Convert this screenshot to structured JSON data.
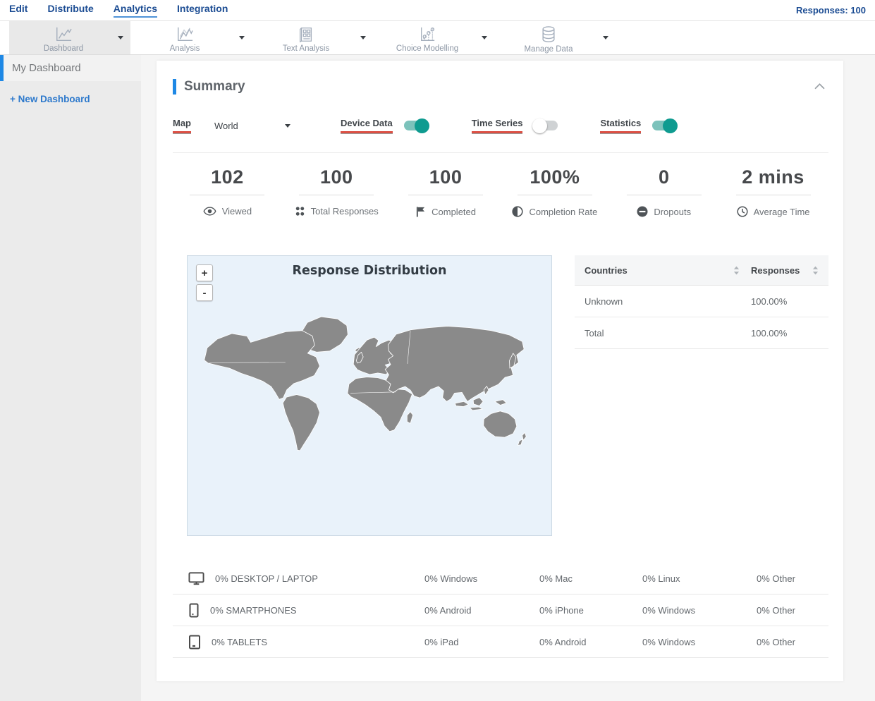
{
  "topnav": {
    "items": [
      {
        "label": "Edit",
        "active": false
      },
      {
        "label": "Distribute",
        "active": false
      },
      {
        "label": "Analytics",
        "active": true
      },
      {
        "label": "Integration",
        "active": false
      }
    ],
    "responses_label": "Responses: 100"
  },
  "toolbar": {
    "items": [
      {
        "label": "Dashboard",
        "icon": "line-chart-icon",
        "selected": true
      },
      {
        "label": "Analysis",
        "icon": "multi-line-chart-icon",
        "selected": false
      },
      {
        "label": "Text Analysis",
        "icon": "document-grid-icon",
        "selected": false
      },
      {
        "label": "Choice Modelling",
        "icon": "scatter-chart-icon",
        "selected": false
      },
      {
        "label": "Manage Data",
        "icon": "database-icon",
        "selected": false
      }
    ]
  },
  "sidebar": {
    "active_item": "My Dashboard",
    "new_dashboard": "+ New Dashboard"
  },
  "summary": {
    "title": "Summary",
    "controls": {
      "map_label": "Map",
      "map_value": "World",
      "device_data_label": "Device Data",
      "device_data_on": true,
      "time_series_label": "Time Series",
      "time_series_on": false,
      "statistics_label": "Statistics",
      "statistics_on": true
    },
    "stats": [
      {
        "value": "102",
        "label": "Viewed",
        "icon": "eye-icon"
      },
      {
        "value": "100",
        "label": "Total Responses",
        "icon": "dots-grid-icon"
      },
      {
        "value": "100",
        "label": "Completed",
        "icon": "flag-icon"
      },
      {
        "value": "100%",
        "label": "Completion Rate",
        "icon": "half-circle-icon"
      },
      {
        "value": "0",
        "label": "Dropouts",
        "icon": "minus-circle-icon"
      },
      {
        "value": "2 mins",
        "label": "Average Time",
        "icon": "clock-icon"
      }
    ],
    "map": {
      "title": "Response Distribution",
      "zoom_in": "+",
      "zoom_out": "-"
    },
    "countries_table": {
      "headers": [
        "Countries",
        "Responses"
      ],
      "rows": [
        {
          "name": "Unknown",
          "value": "100.00%"
        },
        {
          "name": "Total",
          "value": "100.00%"
        }
      ]
    },
    "device_table": {
      "rows": [
        {
          "icon": "desktop-icon",
          "cells": [
            "0% DESKTOP / LAPTOP",
            "0% Windows",
            "0% Mac",
            "0% Linux",
            "0% Other"
          ]
        },
        {
          "icon": "smartphone-icon",
          "cells": [
            "0% SMARTPHONES",
            "0% Android",
            "0% iPhone",
            "0% Windows",
            "0% Other"
          ]
        },
        {
          "icon": "tablet-icon",
          "cells": [
            "0% TABLETS",
            "0% iPad",
            "0% Android",
            "0% Windows",
            "0% Other"
          ]
        }
      ]
    }
  },
  "colors": {
    "nav_blue": "#1b4c93",
    "nav_underline": "#4f93d8",
    "link_blue": "#2d79cc",
    "accent_blue": "#1e88e5",
    "underline_red": "#dc5044",
    "toggle_teal": "#0f9b90",
    "toggle_track": "#7cc2bb",
    "map_land": "#8a8a8a",
    "map_sea": "#e9f2fa"
  }
}
